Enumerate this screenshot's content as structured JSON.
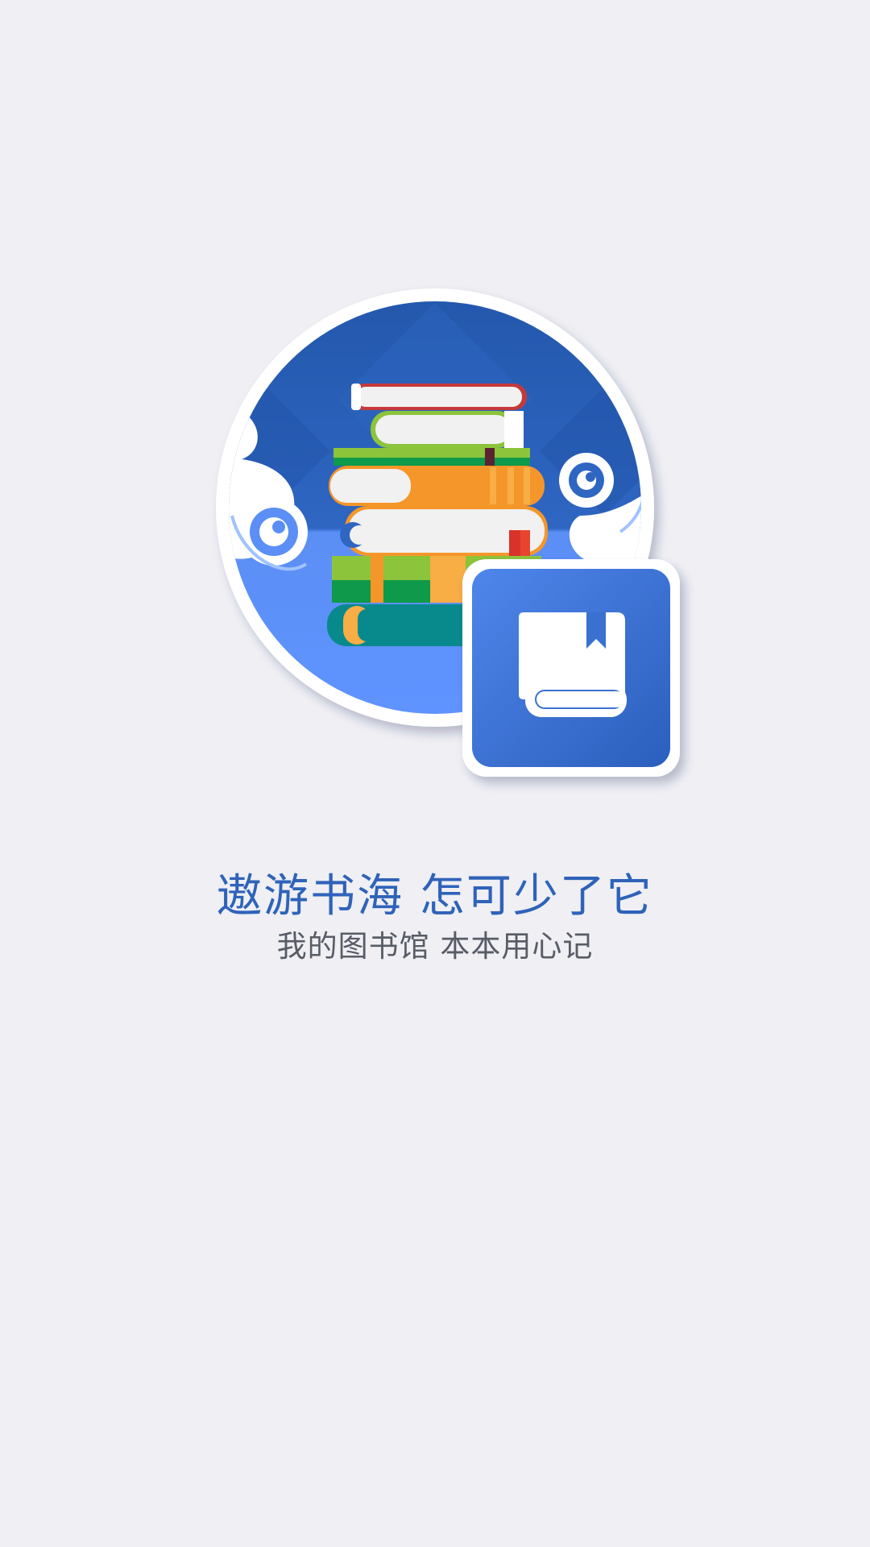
{
  "splash": {
    "headline": "遨游书海 怎可少了它",
    "subline": "我的图书馆 本本用心记"
  },
  "illustration": {
    "main_icon": "book-stack-icon",
    "app_icon": "bookmarked-book-icon"
  },
  "colors": {
    "background": "#efeff4",
    "brand_blue": "#2f63b9",
    "headline": "#2f63b9",
    "subline": "#585c66"
  }
}
